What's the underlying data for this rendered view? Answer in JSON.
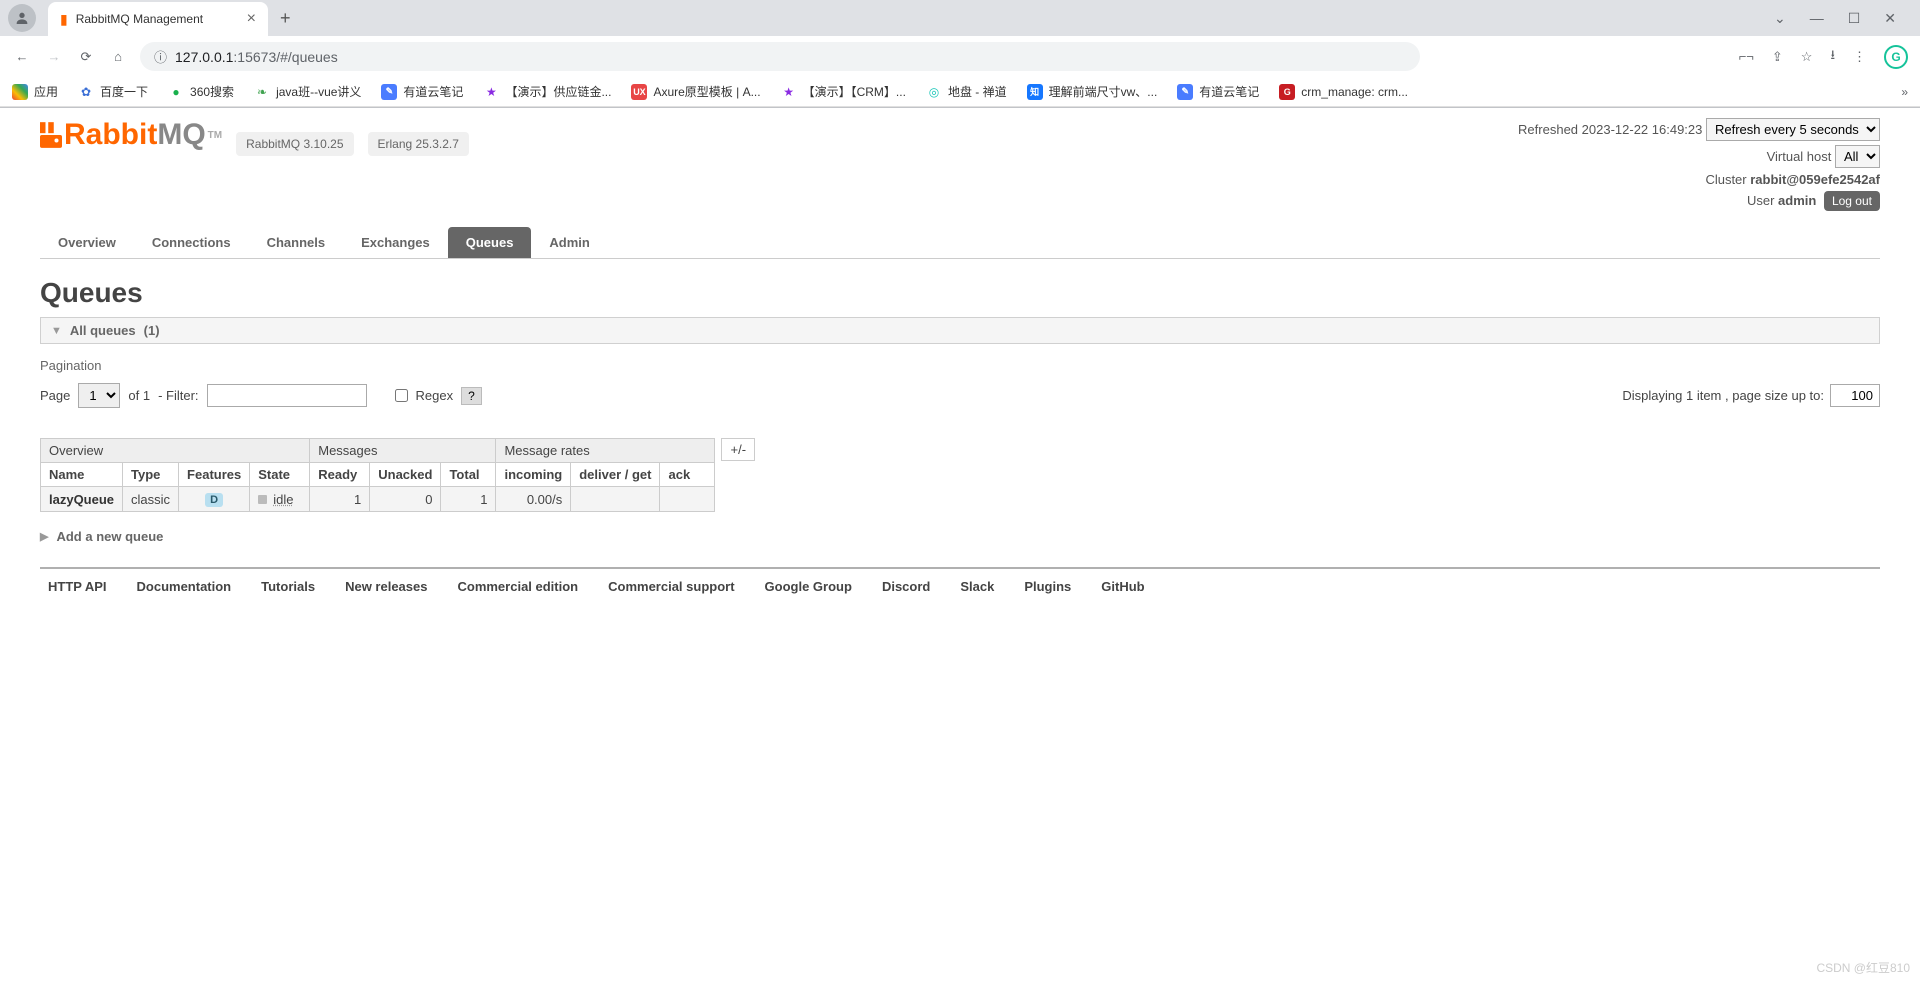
{
  "browser": {
    "tab_title": "RabbitMQ Management",
    "url_prefix": "127.0.0.1",
    "url_suffix": ":15673/#/queues",
    "bookmarks_label": "应用",
    "bookmarks": [
      {
        "label": "百度一下",
        "color": "#3b6fd6",
        "glyph": "✿"
      },
      {
        "label": "360搜索",
        "color": "#18b04c",
        "glyph": "●"
      },
      {
        "label": "java班--vue讲义",
        "color": "#3fa24f",
        "glyph": "❧"
      },
      {
        "label": "有道云笔记",
        "color": "#4a7cff",
        "glyph": "✎",
        "bg": "#4a7cff",
        "white": true
      },
      {
        "label": "【演示】供应链金...",
        "color": "#8a2be2",
        "glyph": "★"
      },
      {
        "label": "Axure原型模板 | A...",
        "color": "#fff",
        "glyph": "UX",
        "bg": "#e84545",
        "white": true
      },
      {
        "label": "【演示】【CRM】...",
        "color": "#8a2be2",
        "glyph": "★"
      },
      {
        "label": "地盘 - 禅道",
        "color": "#16c5b6",
        "glyph": "◎"
      },
      {
        "label": "理解前端尺寸vw、...",
        "color": "#fff",
        "glyph": "知",
        "bg": "#1677ff",
        "white": true
      },
      {
        "label": "有道云笔记",
        "color": "#4a7cff",
        "glyph": "✎",
        "bg": "#4a7cff",
        "white": true
      },
      {
        "label": "crm_manage: crm...",
        "color": "#fff",
        "glyph": "G",
        "bg": "#c71d23",
        "white": true
      }
    ]
  },
  "header": {
    "logo_main": "Rabbit",
    "logo_mq": "MQ",
    "tm": "TM",
    "version": "RabbitMQ 3.10.25",
    "erlang": "Erlang 25.3.2.7",
    "refreshed_label": "Refreshed",
    "refreshed_time": "2023-12-22 16:49:23",
    "refresh_option": "Refresh every 5 seconds",
    "vhost_label": "Virtual host",
    "vhost_value": "All",
    "cluster_label": "Cluster",
    "cluster_value": "rabbit@059efe2542af",
    "user_label": "User",
    "user_value": "admin",
    "logout": "Log out"
  },
  "tabs": [
    "Overview",
    "Connections",
    "Channels",
    "Exchanges",
    "Queues",
    "Admin"
  ],
  "tabs_active": "Queues",
  "page_title": "Queues",
  "all_queues": {
    "label": "All queues",
    "count": "(1)"
  },
  "pagination": {
    "section_label": "Pagination",
    "page_label": "Page",
    "page_value": "1",
    "of_label": "of 1",
    "filter_label": "- Filter:",
    "regex_label": "Regex",
    "help": "?",
    "display_label": "Displaying 1 item , page size up to:",
    "page_size": "100"
  },
  "table": {
    "groups": [
      "Overview",
      "Messages",
      "Message rates"
    ],
    "cols": [
      "Name",
      "Type",
      "Features",
      "State",
      "Ready",
      "Unacked",
      "Total",
      "incoming",
      "deliver / get",
      "ack"
    ],
    "toggle": "+/-",
    "row": {
      "name": "lazyQueue",
      "type": "classic",
      "feature": "D",
      "state": "idle",
      "ready": "1",
      "unacked": "0",
      "total": "1",
      "incoming": "0.00/s",
      "deliver": "",
      "ack": ""
    }
  },
  "add_queue": "Add a new queue",
  "footer": [
    "HTTP API",
    "Documentation",
    "Tutorials",
    "New releases",
    "Commercial edition",
    "Commercial support",
    "Google Group",
    "Discord",
    "Slack",
    "Plugins",
    "GitHub"
  ],
  "watermark": "CSDN @红豆810"
}
